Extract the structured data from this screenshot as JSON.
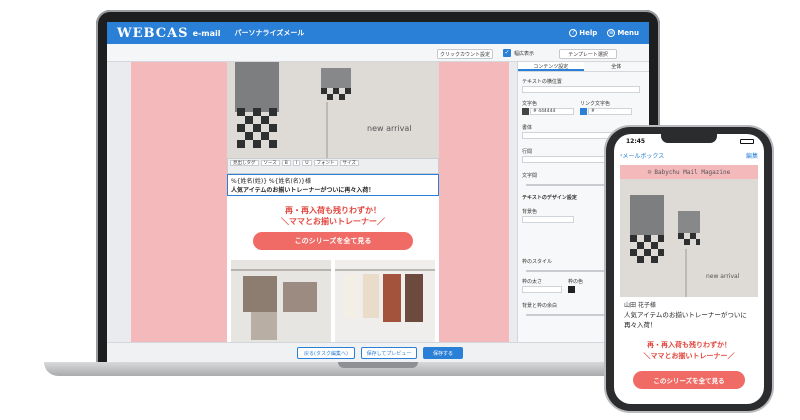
{
  "app": {
    "logo": "WEBCAS",
    "logo_sub": "e-mail",
    "page_title": "パーソナライズメール",
    "help_label": "Help",
    "menu_label": "Menu"
  },
  "toolbar": {
    "click_count_label": "クリックカウント設定",
    "wide_display_label": "幅広表示",
    "template_select_label": "テンプレート選択"
  },
  "email": {
    "hero_caption": "new arrival",
    "editor_tools": [
      "見出しタグ",
      "ソース",
      "フォント",
      "サイズ"
    ],
    "edit_line1": "%{姓名(姓)} %{姓名(名)}様",
    "edit_line2": "人気アイテムのお揃いトレーナーがついに再々入荷！",
    "promo_line1": "再・再入荷も残りわずか！",
    "promo_line2": "＼ママとお揃いトレーナー／",
    "cta_label": "このシリーズを全て見る"
  },
  "panel": {
    "tab_content": "コンテンツ設定",
    "tab_all": "全体",
    "text_align_label": "テキストの横位置",
    "text_color_label": "文字色",
    "link_color_label": "リンク文字色",
    "text_color_value": "# 444444",
    "link_color_value": "#",
    "typeface_label": "書体",
    "line_height_label": "行間",
    "font_size_label": "文字間",
    "text_design_label": "テキストのデザイン設定",
    "bg_label": "背景色",
    "border_style_label": "枠のスタイル",
    "border_width_label": "枠の太さ",
    "border_color_label": "枠の色",
    "padding_label": "背景と枠の余白"
  },
  "bottom": {
    "back_label": "戻る(タスク編集へ)",
    "preview_label": "保存してプレビュー",
    "save_label": "保存する"
  },
  "phone": {
    "time": "12:45",
    "back_label": "メールボックス",
    "edit_label": "編集",
    "banner": "Babychu Mail Magazine",
    "hero_caption": "new arrival",
    "recipient": "山田 花子様",
    "message": "人気アイテムのお揃いトレーナーがついに再々入荷！",
    "promo_line1": "再・再入荷も残りわずか！",
    "promo_line2": "＼ママとお揃いトレーナー／",
    "cta_label": "このシリーズを全て見る"
  },
  "colors": {
    "accent": "#2a7fd6",
    "pink_bg": "#f4b9bb",
    "cta": "#f06b65",
    "promo_red": "#e1463d"
  }
}
